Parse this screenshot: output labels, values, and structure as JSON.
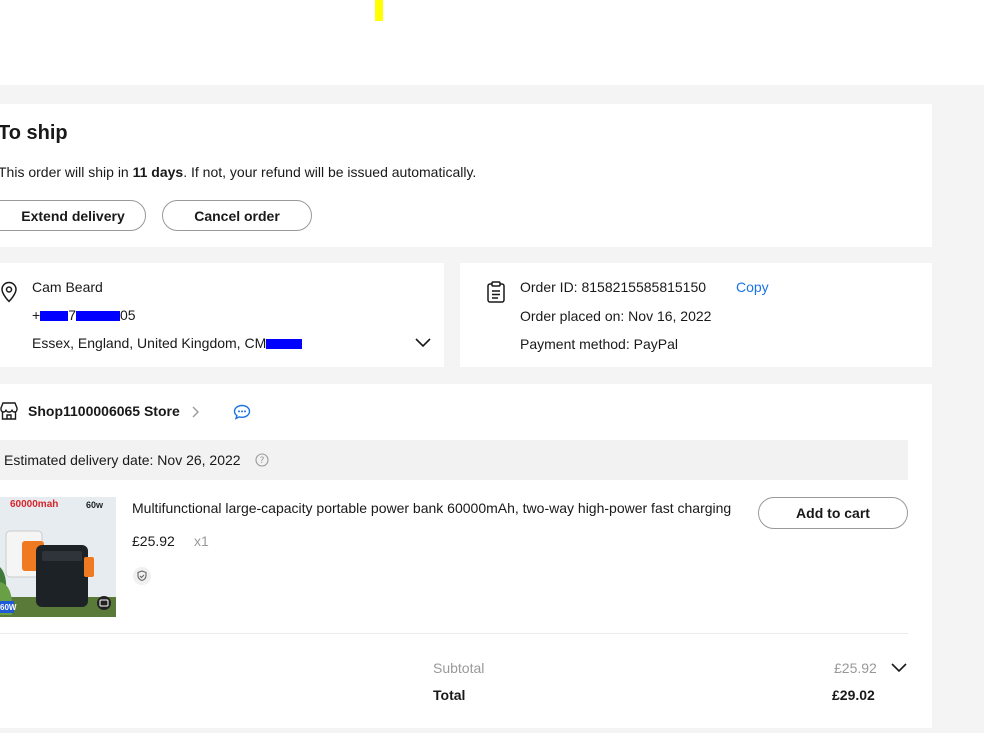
{
  "status": {
    "title": "To ship",
    "note_prefix": "This order will ship in ",
    "note_days": "11 days",
    "note_suffix": ". If not, your refund will be issued automatically.",
    "extend_label": "Extend delivery",
    "cancel_label": "Cancel order"
  },
  "address": {
    "name": "Cam Beard",
    "phone_visible_start": "+",
    "phone_visible_mid": "7",
    "phone_visible_end": "05",
    "location": "Essex, England, United Kingdom, CM"
  },
  "order": {
    "id_text": "Order ID: 8158215585815150",
    "copy_label": "Copy",
    "placed_text": "Order placed on: Nov 16, 2022",
    "payment_text": "Payment method: PayPal"
  },
  "store": {
    "name": "Shop1100006065 Store",
    "delivery_text": "Estimated delivery date: Nov 26, 2022"
  },
  "product": {
    "title": "Multifunctional large-capacity portable power bank 60000mAh, two-way high-power fast charging",
    "price": "£25.92",
    "qty": "x1",
    "add_to_cart_label": "Add to cart",
    "image_label_top": "60000mah",
    "image_badge": "60w",
    "image_corner": "60W"
  },
  "totals": {
    "subtotal_label": "Subtotal",
    "subtotal_value": "£25.92",
    "total_label": "Total",
    "total_value": "£29.02"
  },
  "colors": {
    "accent_link": "#1a73e8",
    "redaction": "#0000ff",
    "background": "#f4f4f4"
  }
}
